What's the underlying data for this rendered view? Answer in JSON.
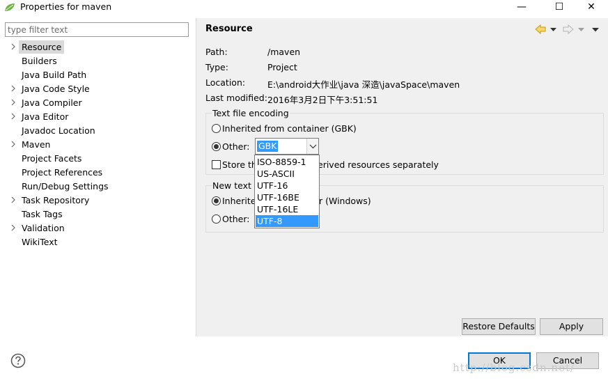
{
  "window": {
    "title": "Properties for maven",
    "minimize": "—",
    "maximize": "☐",
    "close": "✕"
  },
  "filter": {
    "placeholder": "type filter text",
    "value": ""
  },
  "nav": {
    "items": [
      {
        "label": "Resource",
        "expandable": true,
        "selected": true
      },
      {
        "label": "Builders",
        "expandable": false
      },
      {
        "label": "Java Build Path",
        "expandable": false
      },
      {
        "label": "Java Code Style",
        "expandable": true
      },
      {
        "label": "Java Compiler",
        "expandable": true
      },
      {
        "label": "Java Editor",
        "expandable": true
      },
      {
        "label": "Javadoc Location",
        "expandable": false
      },
      {
        "label": "Maven",
        "expandable": true
      },
      {
        "label": "Project Facets",
        "expandable": false
      },
      {
        "label": "Project References",
        "expandable": false
      },
      {
        "label": "Run/Debug Settings",
        "expandable": false
      },
      {
        "label": "Task Repository",
        "expandable": true
      },
      {
        "label": "Task Tags",
        "expandable": false
      },
      {
        "label": "Validation",
        "expandable": true
      },
      {
        "label": "WikiText",
        "expandable": false
      }
    ]
  },
  "page": {
    "title": "Resource",
    "properties": [
      {
        "label": "Path:",
        "value": "/maven"
      },
      {
        "label": "Type:",
        "value": "Project"
      },
      {
        "label": "Location:",
        "value": "E:\\android大作业\\java  深造\\javaSpace\\maven"
      },
      {
        "label": "Last modified:",
        "value": "2016年3月2日下午3:51:51"
      }
    ],
    "text_encoding": {
      "title": "Text file encoding",
      "inherited_label": "Inherited from container (GBK)",
      "other_label": "Other:",
      "other_value": "GBK",
      "store_prefix": "Store th",
      "store_suffix": "erived resources separately"
    },
    "line_delimiter": {
      "title_prefix": "New text f",
      "inherited_prefix": "Inherited",
      "inherited_suffix": "r (Windows)",
      "other_label": "Other:"
    },
    "encoding_options": [
      "ISO-8859-1",
      "US-ASCII",
      "UTF-16",
      "UTF-16BE",
      "UTF-16LE",
      "UTF-8"
    ],
    "highlighted_option": "UTF-8"
  },
  "buttons": {
    "restore_defaults": "Restore Defaults",
    "apply": "Apply",
    "ok": "OK",
    "cancel": "Cancel"
  },
  "watermark": "http://blog.csdn.net/",
  "colors": {
    "selection": "#3399ff",
    "pane_bg": "#f0f0f0",
    "default_button_border": "#0078d7",
    "history_arrow": "#d9a400"
  }
}
